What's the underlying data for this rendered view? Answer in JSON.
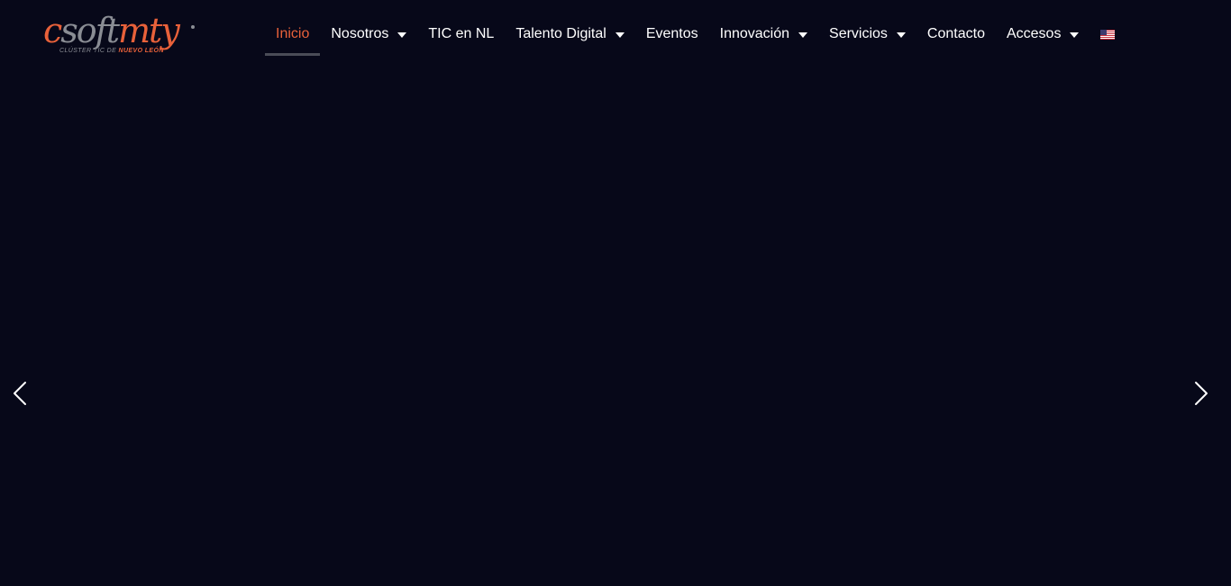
{
  "logo": {
    "part1": "c",
    "part2": "soft",
    "part3": "mty",
    "tagline_prefix": "CLÚSTER TIC DE ",
    "tagline_highlight": "NUEVO LEÓN"
  },
  "nav": {
    "items": [
      {
        "label": "Inicio",
        "active": true,
        "dropdown": false
      },
      {
        "label": "Nosotros",
        "active": false,
        "dropdown": true
      },
      {
        "label": "TIC en NL",
        "active": false,
        "dropdown": false
      },
      {
        "label": "Talento Digital",
        "active": false,
        "dropdown": true
      },
      {
        "label": "Eventos",
        "active": false,
        "dropdown": false
      },
      {
        "label": "Innovación",
        "active": false,
        "dropdown": true
      },
      {
        "label": "Servicios",
        "active": false,
        "dropdown": true
      },
      {
        "label": "Contacto",
        "active": false,
        "dropdown": false
      },
      {
        "label": "Accesos",
        "active": false,
        "dropdown": true
      }
    ],
    "language_icon": "us-flag-icon"
  },
  "slider": {
    "prev_icon": "chevron-left-icon",
    "next_icon": "chevron-right-icon"
  },
  "colors": {
    "background": "#070819",
    "accent": "#e8613a",
    "nav_text": "#ffffff",
    "active_underline": "#4a4c57"
  }
}
